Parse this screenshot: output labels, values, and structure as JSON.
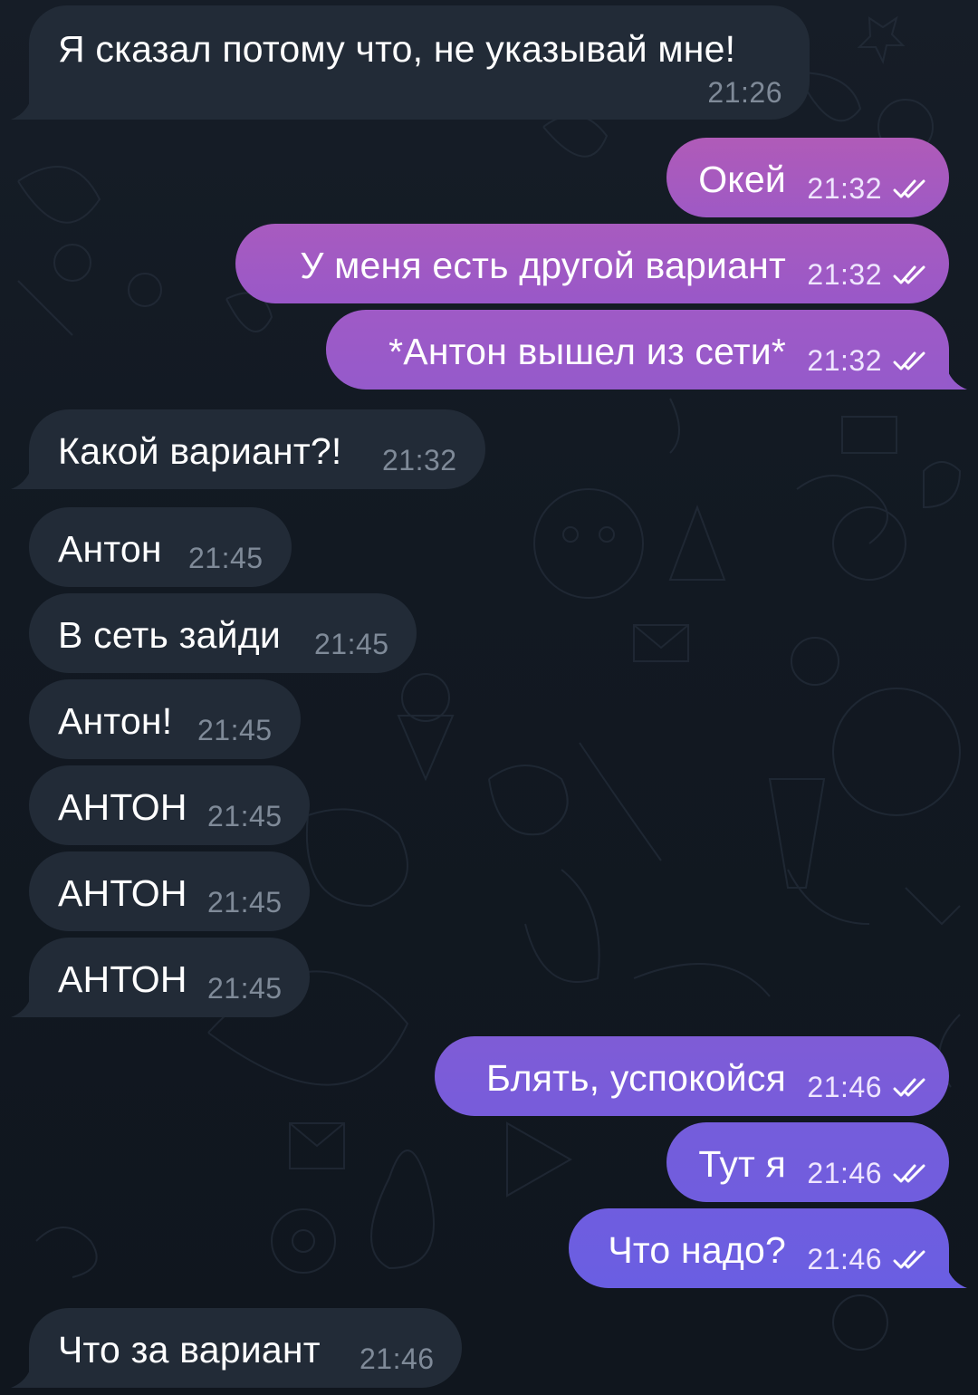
{
  "chat": {
    "messages": [
      {
        "dir": "in",
        "text": "Я сказал потому что, не указывай мне!",
        "time": "21:26"
      },
      {
        "dir": "out",
        "text": "Окей",
        "time": "21:32",
        "status": "read"
      },
      {
        "dir": "out",
        "text": "У меня есть другой вариант",
        "time": "21:32",
        "status": "read"
      },
      {
        "dir": "out",
        "text": "*Антон вышел из сети*",
        "time": "21:32",
        "status": "read"
      },
      {
        "dir": "in",
        "text": "Какой вариант?!",
        "time": "21:32"
      },
      {
        "dir": "in",
        "text": "Антон",
        "time": "21:45"
      },
      {
        "dir": "in",
        "text": "В сеть зайди",
        "time": "21:45"
      },
      {
        "dir": "in",
        "text": "Антон!",
        "time": "21:45"
      },
      {
        "dir": "in",
        "text": "АНТОН",
        "time": "21:45"
      },
      {
        "dir": "in",
        "text": "АНТОН",
        "time": "21:45"
      },
      {
        "dir": "in",
        "text": "АНТОН",
        "time": "21:45"
      },
      {
        "dir": "out",
        "text": "Блять, успокойся",
        "time": "21:46",
        "status": "read"
      },
      {
        "dir": "out",
        "text": "Тут я",
        "time": "21:46",
        "status": "read"
      },
      {
        "dir": "out",
        "text": "Что надо?",
        "time": "21:46",
        "status": "read"
      },
      {
        "dir": "in",
        "text": "Что за вариант",
        "time": "21:46"
      }
    ]
  },
  "colors": {
    "incoming_bubble": "#222b37",
    "outgoing_gradient_top": "#a05ac0",
    "outgoing_gradient_bottom": "#6d5ee0",
    "background": "#121922"
  },
  "icons": {
    "read_receipt": "double-check-icon"
  }
}
